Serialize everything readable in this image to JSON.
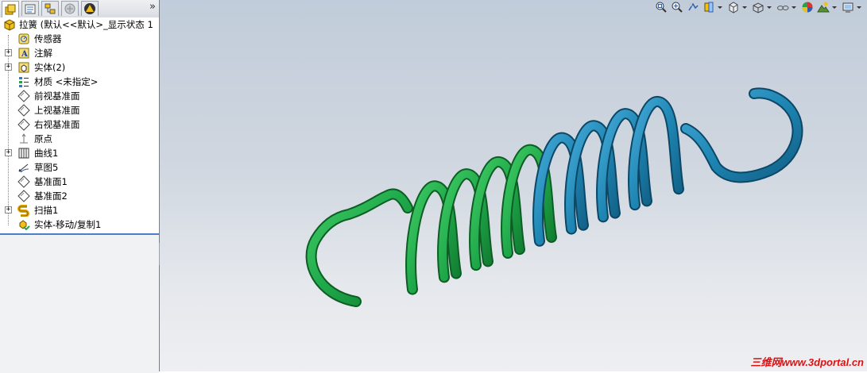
{
  "feature_manager": {
    "tabs": [
      "feature-manager-tab",
      "property-manager-tab",
      "configuration-manager-tab",
      "dimxpert-tab",
      "display-manager-tab"
    ],
    "expand_glyph": "»",
    "root_label": "拉簧  (默认<<默认>_显示状态 1",
    "items": [
      {
        "label": "传感器",
        "icon": "sensor-icon",
        "expandable": false
      },
      {
        "label": "注解",
        "icon": "annotation-icon",
        "expandable": true
      },
      {
        "label": "实体(2)",
        "icon": "solid-bodies-icon",
        "expandable": true
      },
      {
        "label": "材质 <未指定>",
        "icon": "material-icon",
        "expandable": false
      },
      {
        "label": "前视基准面",
        "icon": "plane-icon",
        "expandable": false
      },
      {
        "label": "上视基准面",
        "icon": "plane-icon",
        "expandable": false
      },
      {
        "label": "右视基准面",
        "icon": "plane-icon",
        "expandable": false
      },
      {
        "label": "原点",
        "icon": "origin-icon",
        "expandable": false
      },
      {
        "label": "曲线1",
        "icon": "helix-curve-icon",
        "expandable": true
      },
      {
        "label": "草图5",
        "icon": "sketch-icon",
        "expandable": false
      },
      {
        "label": "基准面1",
        "icon": "plane-icon",
        "expandable": false
      },
      {
        "label": "基准面2",
        "icon": "plane-icon",
        "expandable": false
      },
      {
        "label": "扫描1",
        "icon": "sweep-icon",
        "expandable": true
      },
      {
        "label": "实体-移动/复制1",
        "icon": "move-copy-body-icon",
        "expandable": false
      }
    ]
  },
  "view_toolbar": [
    "zoom-to-fit-icon",
    "zoom-to-area-icon",
    "previous-view-icon",
    "section-view-icon",
    "view-orientation-icon",
    "display-style-icon",
    "hide-show-items-icon",
    "edit-appearance-icon",
    "apply-scene-icon",
    "view-settings-icon"
  ],
  "model": {
    "green_half_color": "#1fa84a",
    "blue_half_color": "#1f86b4"
  },
  "watermark": "三维网www.3dportal.cn"
}
